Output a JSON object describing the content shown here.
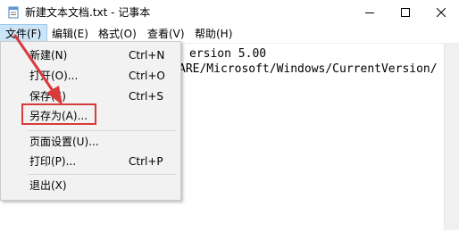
{
  "window": {
    "title": "新建文本文档.txt - 记事本",
    "icon": "notepad-icon",
    "controls": [
      "minimize-icon",
      "maximize-icon",
      "close-icon"
    ]
  },
  "menubar": {
    "items": [
      {
        "label": "文件(F)"
      },
      {
        "label": "编辑(E)"
      },
      {
        "label": "格式(O)"
      },
      {
        "label": "查看(V)"
      },
      {
        "label": "帮助(H)"
      }
    ]
  },
  "editor": {
    "lines": [
      "ersion 5.00",
      "ARE/Microsoft/Windows/CurrentVersion/"
    ]
  },
  "file_menu": {
    "items": [
      {
        "label": "新建(N)",
        "shortcut": "Ctrl+N"
      },
      {
        "label": "打开(O)...",
        "shortcut": "Ctrl+O"
      },
      {
        "label": "保存(S)",
        "shortcut": "Ctrl+S"
      },
      {
        "label": "另存为(A)...",
        "shortcut": ""
      },
      {
        "label": "页面设置(U)...",
        "shortcut": ""
      },
      {
        "label": "打印(P)...",
        "shortcut": "Ctrl+P"
      },
      {
        "label": "退出(X)",
        "shortcut": ""
      }
    ]
  },
  "colors": {
    "annotation": "#d93a3a",
    "menu_active": "#cce4f7"
  }
}
